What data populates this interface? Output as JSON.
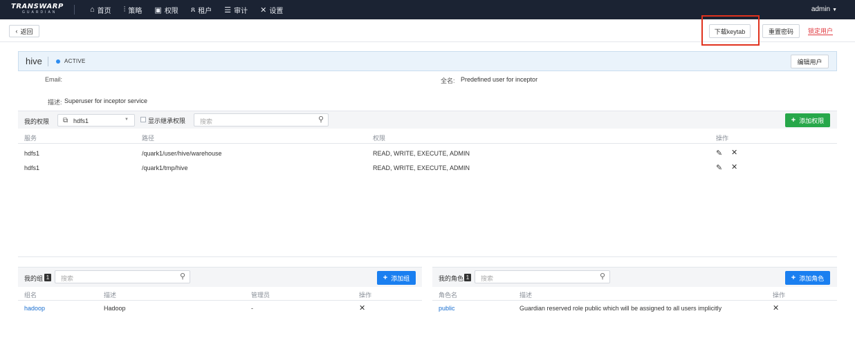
{
  "header": {
    "logo_top": "TRANSWARP",
    "logo_bottom": "GUARDIAN",
    "nav": [
      {
        "icon": "⌂",
        "label": "首页"
      },
      {
        "icon": "⫶",
        "label": "策略"
      },
      {
        "icon": "▣",
        "label": "权限"
      },
      {
        "icon": "ጸ",
        "label": "租户"
      },
      {
        "icon": "☰",
        "label": "审计"
      },
      {
        "icon": "✕",
        "label": "设置"
      }
    ],
    "user": "admin"
  },
  "toolbar": {
    "back_label": "返回",
    "download_keytab": "下载keytab",
    "reset_password": "重置密码",
    "lock_user": "锁定用户"
  },
  "profile": {
    "username": "hive",
    "status": "ACTIVE",
    "edit_label": "编辑用户",
    "email_label": "Email:",
    "email_value": "",
    "fullname_label": "全名:",
    "fullname_value": "Predefined user for inceptor",
    "desc_label": "描述:",
    "desc_value": "Superuser for inceptor service"
  },
  "permissions": {
    "title": "我的权限",
    "service_selected": "hdfs1",
    "show_inherited_label": "显示继承权限",
    "search_placeholder": "搜索",
    "add_label": "添加权限",
    "columns": [
      "服务",
      "路径",
      "权限",
      "操作"
    ],
    "rows": [
      {
        "service": "hdfs1",
        "path": "/quark1/user/hive/warehouse",
        "perm": "READ, WRITE, EXECUTE, ADMIN"
      },
      {
        "service": "hdfs1",
        "path": "/quark1/tmp/hive",
        "perm": "READ, WRITE, EXECUTE, ADMIN"
      }
    ]
  },
  "groups": {
    "title": "我的组",
    "count": "1",
    "search_placeholder": "搜索",
    "add_label": "添加组",
    "columns": [
      "组名",
      "描述",
      "管理员",
      "操作"
    ],
    "rows": [
      {
        "name": "hadoop",
        "desc": "Hadoop",
        "admin": "-"
      }
    ]
  },
  "roles": {
    "title": "我的角色",
    "count": "1",
    "search_placeholder": "搜索",
    "add_label": "添加角色",
    "columns": [
      "角色名",
      "描述",
      "操作"
    ],
    "rows": [
      {
        "name": "public",
        "desc": "Guardian reserved role public which will be assigned to all users implicitly"
      }
    ]
  },
  "colors": {
    "nav_bg": "#1b2333",
    "accent_blue": "#1a7ff0",
    "accent_green": "#27a74a",
    "danger": "#e0383e",
    "highlight_box": "#e0321e"
  }
}
